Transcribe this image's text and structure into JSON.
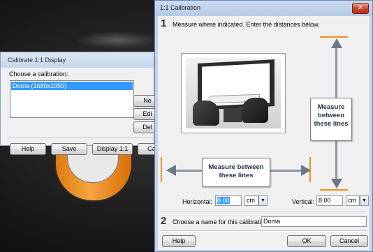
{
  "small_dialog": {
    "title": "Calibrate 1:1 Display",
    "choose_label": "Choose a calibration:",
    "list_items": [
      "Doma (1680x1050)"
    ],
    "side_buttons": [
      "Ne",
      "Edi",
      "Del"
    ],
    "bottom_buttons": [
      "Help",
      "Save",
      "Display 1:1",
      "Ca"
    ]
  },
  "main_dialog": {
    "title": "1:1 Calibration",
    "close_glyph": "✕",
    "step1": {
      "number": "1",
      "text": "Measure where indicated. Enter the distances below."
    },
    "callout_horizontal": [
      "Measure between",
      "these lines"
    ],
    "callout_vertical": [
      "Measure",
      "between",
      "these lines"
    ],
    "horizontal": {
      "label": "Horizontal:",
      "value": "8.00",
      "unit": "cm"
    },
    "vertical": {
      "label": "Vertical:",
      "value": "8.00",
      "unit": "cm"
    },
    "step2": {
      "number": "2",
      "text": "Choose a name for this calibration:",
      "value": "Doma"
    },
    "buttons": {
      "help": "Help",
      "ok": "OK",
      "cancel": "Cancel"
    }
  },
  "icons": {
    "close": "close-icon",
    "dropdown": "chevron-down-icon"
  },
  "colors": {
    "accent_marks": "#f0921c",
    "selection": "#3399ff"
  }
}
